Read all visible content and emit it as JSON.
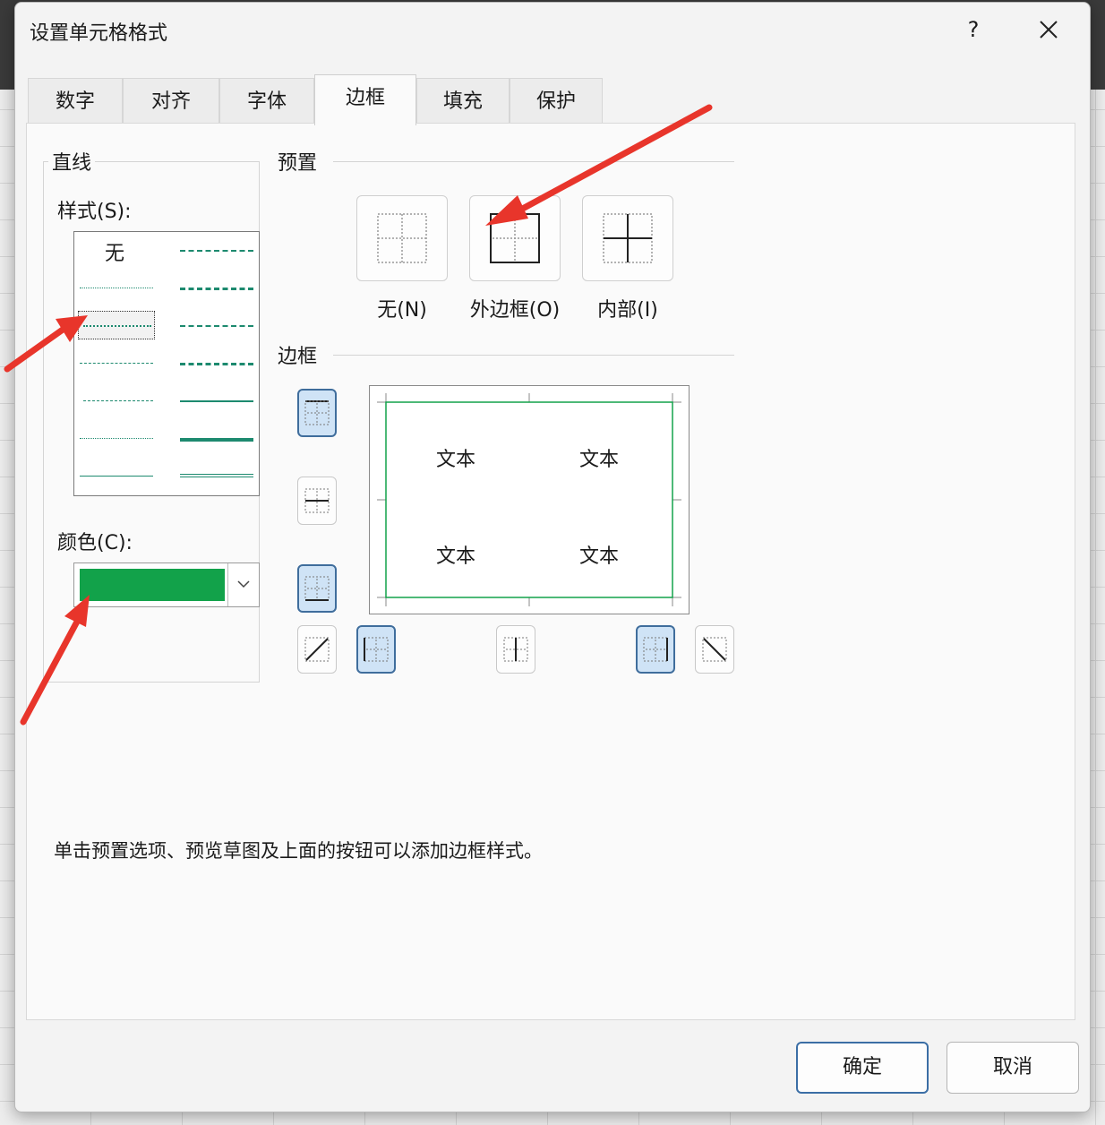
{
  "window": {
    "title": "设置单元格格式",
    "help_label": "?"
  },
  "tabs": [
    {
      "label": "数字",
      "active": false
    },
    {
      "label": "对齐",
      "active": false
    },
    {
      "label": "字体",
      "active": false
    },
    {
      "label": "边框",
      "active": true
    },
    {
      "label": "填充",
      "active": false
    },
    {
      "label": "保护",
      "active": false
    }
  ],
  "line_group": {
    "legend": "直线",
    "style_label": "样式(S):",
    "style_none_label": "无",
    "selected_style": "dotted",
    "color_label": "颜色(C):",
    "color_value": "#12a24a"
  },
  "presets": {
    "legend": "预置",
    "items": [
      {
        "label": "无(N)",
        "icon": "preset-none-icon"
      },
      {
        "label": "外边框(O)",
        "icon": "preset-outline-icon"
      },
      {
        "label": "内部(I)",
        "icon": "preset-inside-icon"
      }
    ]
  },
  "border": {
    "legend": "边框",
    "preview_text": [
      "文本",
      "文本",
      "文本",
      "文本"
    ],
    "active_sides": [
      "top",
      "bottom",
      "left",
      "right"
    ],
    "line_color": "#12a24a"
  },
  "hint": "单击预置选项、预览草图及上面的按钮可以添加边框样式。",
  "buttons": {
    "ok": "确定",
    "cancel": "取消"
  },
  "colors": {
    "accent": "#3b6ea5",
    "annotation_arrow": "#e8352b",
    "line_style": "#1d8a6f"
  }
}
